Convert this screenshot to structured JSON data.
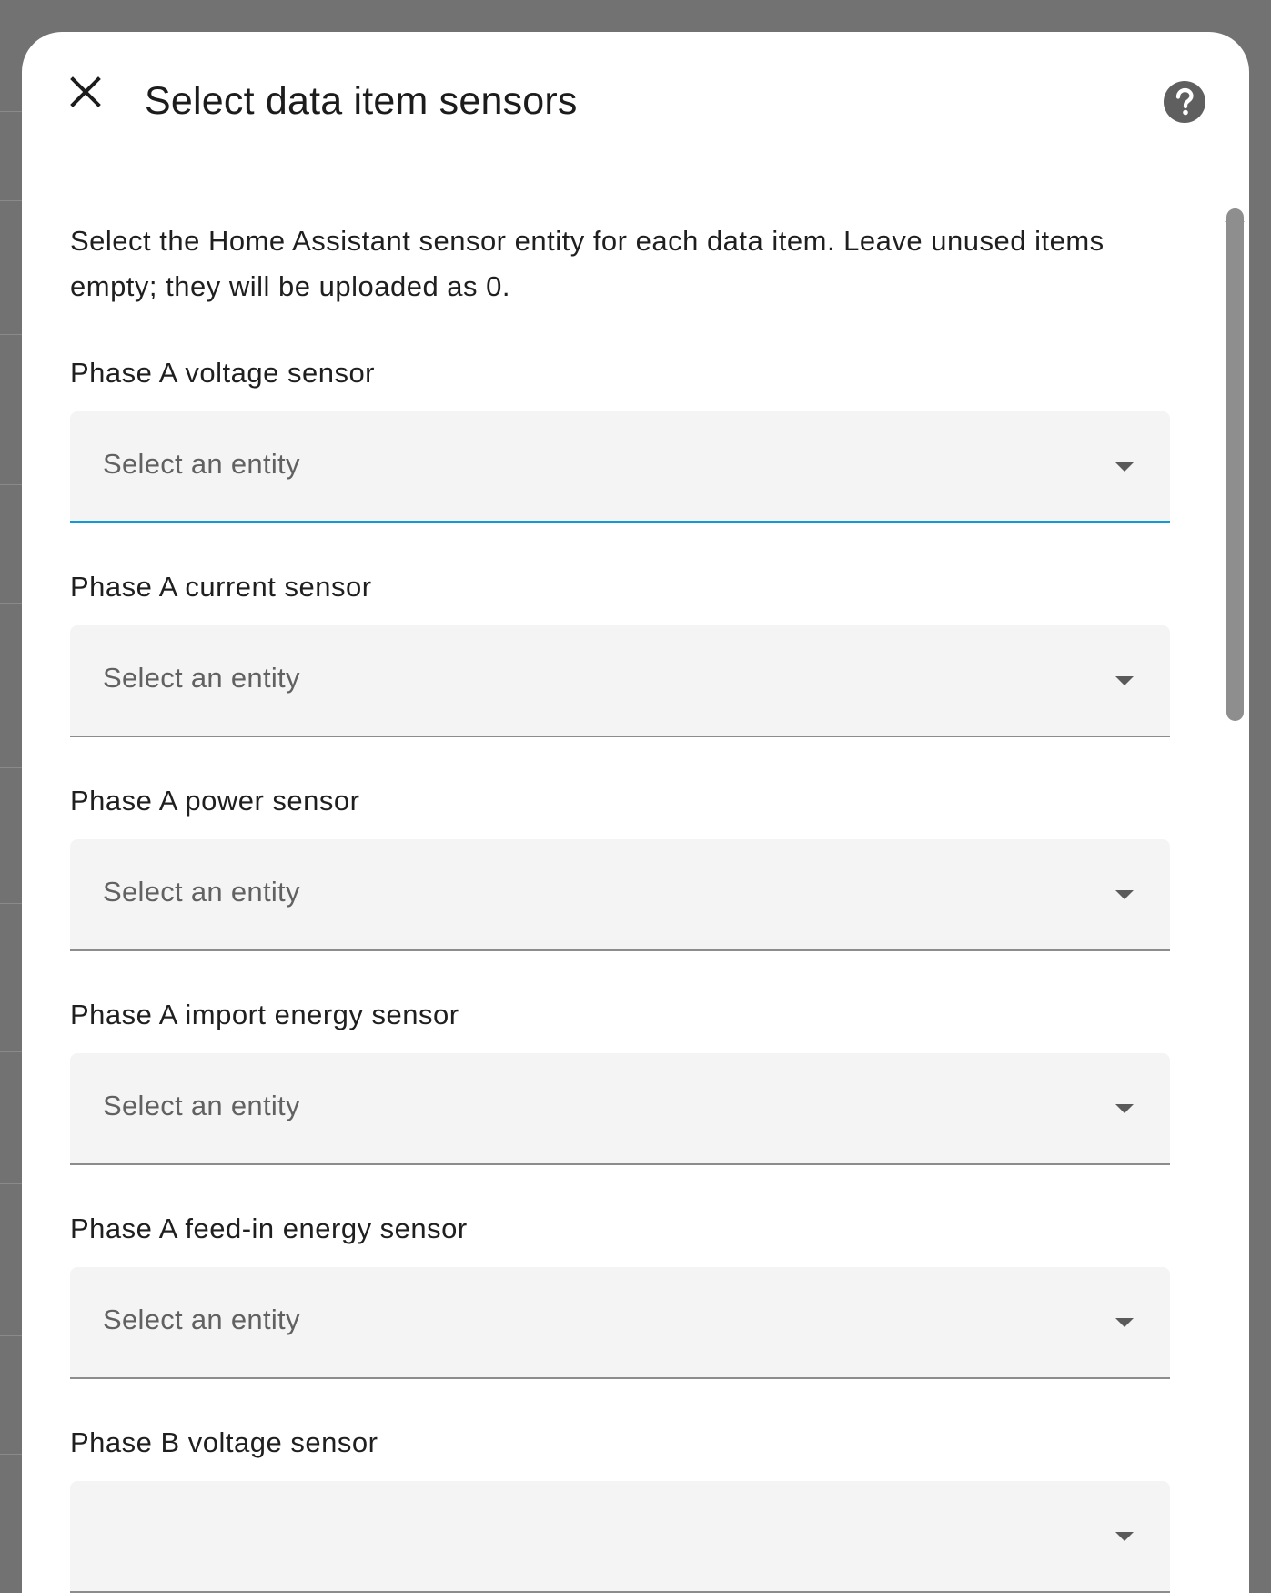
{
  "dialog": {
    "title": "Select data item sensors",
    "close_icon": "close-icon",
    "help_icon": "help-circle-icon",
    "description": "Select the Home Assistant sensor entity for each data item. Leave unused items empty; they will be uploaded as 0."
  },
  "fields": [
    {
      "label": "Phase A voltage sensor",
      "placeholder": "Select an entity",
      "focused": true
    },
    {
      "label": "Phase A current sensor",
      "placeholder": "Select an entity",
      "focused": false
    },
    {
      "label": "Phase A power sensor",
      "placeholder": "Select an entity",
      "focused": false
    },
    {
      "label": "Phase A import energy sensor",
      "placeholder": "Select an entity",
      "focused": false
    },
    {
      "label": "Phase A feed-in energy sensor",
      "placeholder": "Select an entity",
      "focused": false
    },
    {
      "label": "Phase B voltage sensor",
      "placeholder": "",
      "focused": false
    }
  ],
  "colors": {
    "focus_underline": "#109bd6",
    "field_background": "#f4f4f4",
    "overlay": "#727272"
  }
}
